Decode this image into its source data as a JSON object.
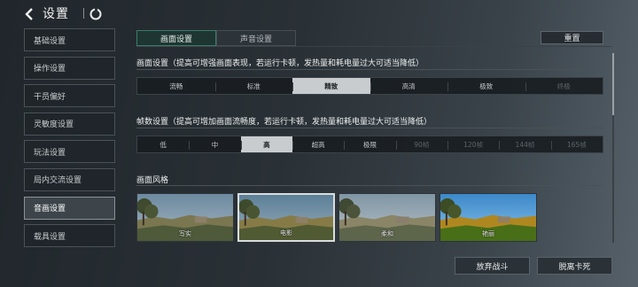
{
  "header": {
    "title": "设置"
  },
  "sidebar": {
    "items": [
      {
        "label": "基础设置"
      },
      {
        "label": "操作设置"
      },
      {
        "label": "干员偏好"
      },
      {
        "label": "灵敏度设置"
      },
      {
        "label": "玩法设置"
      },
      {
        "label": "局内交流设置"
      },
      {
        "label": "音画设置"
      },
      {
        "label": "载具设置"
      }
    ]
  },
  "tabs": [
    {
      "label": "画面设置"
    },
    {
      "label": "声音设置"
    }
  ],
  "reset_label": "重置",
  "quality": {
    "title": "画面设置（提高可增强画面表现，若运行卡顿，发热量和耗电量过大可适当降低）",
    "options": [
      "流畅",
      "标准",
      "精致",
      "高清",
      "极致",
      "终极"
    ],
    "selected": "精致"
  },
  "framerate": {
    "title": "帧数设置（提高可增加画面流畅度，若运行卡顿，发热量和耗电量过大可适当降低）",
    "options": [
      "低",
      "中",
      "高",
      "超高",
      "极限",
      "90帧",
      "120帧",
      "144帧",
      "165帧"
    ],
    "selected": "高"
  },
  "style": {
    "title": "画面风格",
    "options": [
      "写实",
      "电影",
      "柔和",
      "艳丽"
    ],
    "selected": "电影"
  },
  "footer": {
    "abandon_label": "放弃战斗",
    "unstuck_label": "脱离卡死"
  },
  "colors": {
    "accent_tab": "#3b7a6a",
    "selected_segment": "#c9cccf"
  }
}
